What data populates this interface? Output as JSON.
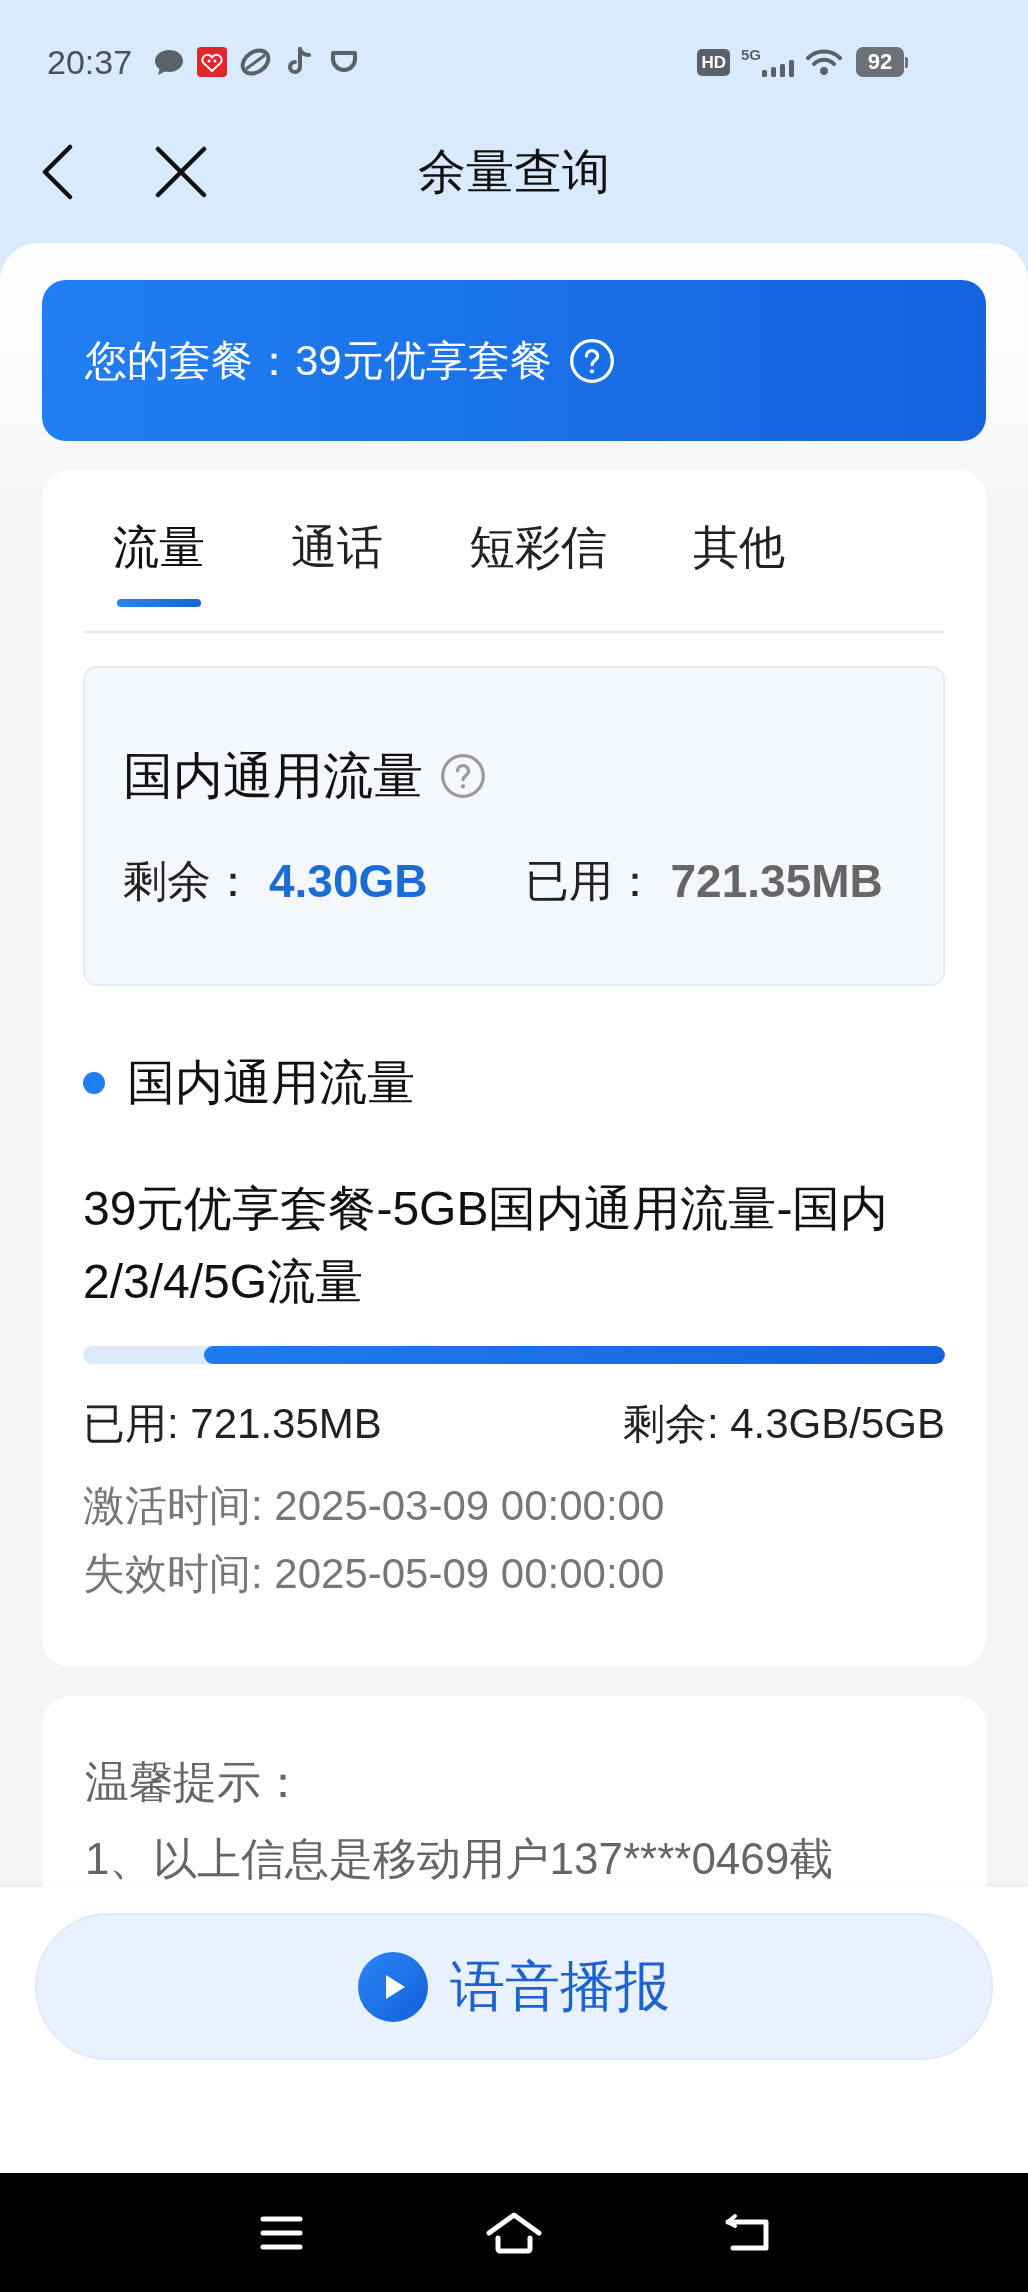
{
  "status_bar": {
    "time": "20:37",
    "hd": "HD",
    "network": "5G",
    "battery": "92"
  },
  "header": {
    "title": "余量查询"
  },
  "plan": {
    "label": "您的套餐：",
    "name": "39元优享套餐"
  },
  "tabs": [
    {
      "label": "流量",
      "selected": true
    },
    {
      "label": "通话",
      "selected": false
    },
    {
      "label": "短彩信",
      "selected": false
    },
    {
      "label": "其他",
      "selected": false
    }
  ],
  "summary": {
    "title": "国内通用流量",
    "remaining_label": "剩余：",
    "remaining": "4.30GB",
    "used_label": "已用：",
    "used": "721.35MB"
  },
  "section": {
    "title": "国内通用流量"
  },
  "package": {
    "name": "39元优享套餐-5GB国内通用流量-国内2/3/4/5G流量",
    "level": 0.86,
    "used": "已用: 721.35MB",
    "remaining": "剩余: 4.3GB/5GB",
    "activated": "激活时间: 2025-03-09 00:00:00",
    "expires": "失效时间: 2025-05-09 00:00:00"
  },
  "tips": {
    "title": "温馨提示：",
    "lines": [
      "1、以上信息是移动用户137****0469截"
    ]
  },
  "voice_button": {
    "label": "语音播报"
  }
}
